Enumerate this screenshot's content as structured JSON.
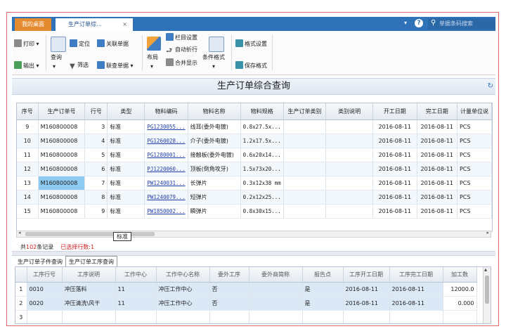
{
  "tabs": {
    "desktop": "我的桌面",
    "active": "生产订单综…",
    "close": "×"
  },
  "topbar": {
    "dropdown": "▾",
    "help": "?",
    "search_placeholder": "单据条码搜索"
  },
  "toolbar": {
    "print": "打印",
    "export": "输出",
    "query": "查询",
    "locate": "定位",
    "filter": "筛选",
    "related": "关联单据",
    "linked_query": "联查单据",
    "layout": "布局",
    "column_settings": "栏目设置",
    "auto_wrap": "自动折行",
    "merge_display": "合并显示",
    "condition_format": "条件格式",
    "format_settings": "格式设置",
    "save_format": "保存格式",
    "arrow": "▾"
  },
  "page_title": "生产订单综合查询",
  "main_grid": {
    "columns": [
      "序号",
      "生产订单号",
      "行号",
      "类型",
      "物料编码",
      "物料名称",
      "物料规格",
      "生产订单类别",
      "类别说明",
      "开工日期",
      "完工日期",
      "计量单位说"
    ],
    "rows": [
      [
        "9",
        "M160800008",
        "3",
        "标准",
        "PG1230055...",
        "线耳(委外电镀)",
        "0.8x27.5x...",
        "",
        "",
        "2016-08-11",
        "2016-08-11",
        "PCS"
      ],
      [
        "10",
        "M160800008",
        "4",
        "标准",
        "PG1260028...",
        "介子(委外电镀)",
        "1.2x17.5x...",
        "",
        "",
        "2016-08-11",
        "2016-08-11",
        "PCS"
      ],
      [
        "11",
        "M160800008",
        "5",
        "标准",
        "PG1280001...",
        "接触板(委外电镀)",
        "0.6x20x14...",
        "",
        "",
        "2016-08-11",
        "2016-08-11",
        "PCS"
      ],
      [
        "12",
        "M160800008",
        "6",
        "标准",
        "PJ1220060...",
        "顶板(倒角攻牙)",
        "1.5x73x20...",
        "",
        "",
        "2016-08-11",
        "2016-08-11",
        "PCS"
      ],
      [
        "13",
        "M160800008",
        "7",
        "标准",
        "PW1240031...",
        "长弹片",
        "0.3x12x38 mm",
        "",
        "",
        "2016-08-11",
        "2016-08-11",
        "PCS"
      ],
      [
        "14",
        "M160800008",
        "8",
        "标准",
        "PW1240079...",
        "短弹片",
        "0.2x12x25...",
        "",
        "",
        "2016-08-11",
        "2016-08-11",
        "PCS"
      ],
      [
        "15",
        "M160800008",
        "9",
        "标准",
        "PW1850002...",
        "瞬弹片",
        "0.8x30x15...",
        "",
        "",
        "2016-08-11",
        "2016-08-11",
        "PCS"
      ]
    ],
    "selected_row": 4,
    "tooltip": "标准"
  },
  "records": {
    "prefix": "共",
    "count": "102",
    "suffix": "条记录",
    "selected": "已选择行数:1"
  },
  "bottom_tabs": [
    "生产订单子件查询",
    "生产订单工序查询"
  ],
  "sub_grid": {
    "columns": [
      "",
      "工序行号",
      "工序说明",
      "工作中心",
      "工作中心名称",
      "委外工序",
      "委外商简称",
      "报告点",
      "工序开工日期",
      "工序完工日期",
      "加工数"
    ],
    "rows": [
      [
        "1",
        "0010",
        "冲压落料",
        "11",
        "冲压工作中心",
        "否",
        "",
        "是",
        "2016-08-11",
        "2016-08-11",
        "12000.0"
      ],
      [
        "2",
        "0020",
        "冲压清洗\\风干",
        "11",
        "冲压工作中心",
        "否",
        "",
        "是",
        "2016-08-11",
        "2016-08-11",
        "0.000"
      ],
      [
        "3",
        "",
        "",
        "",
        "",
        "",
        "",
        "",
        "",
        "",
        ""
      ]
    ]
  }
}
